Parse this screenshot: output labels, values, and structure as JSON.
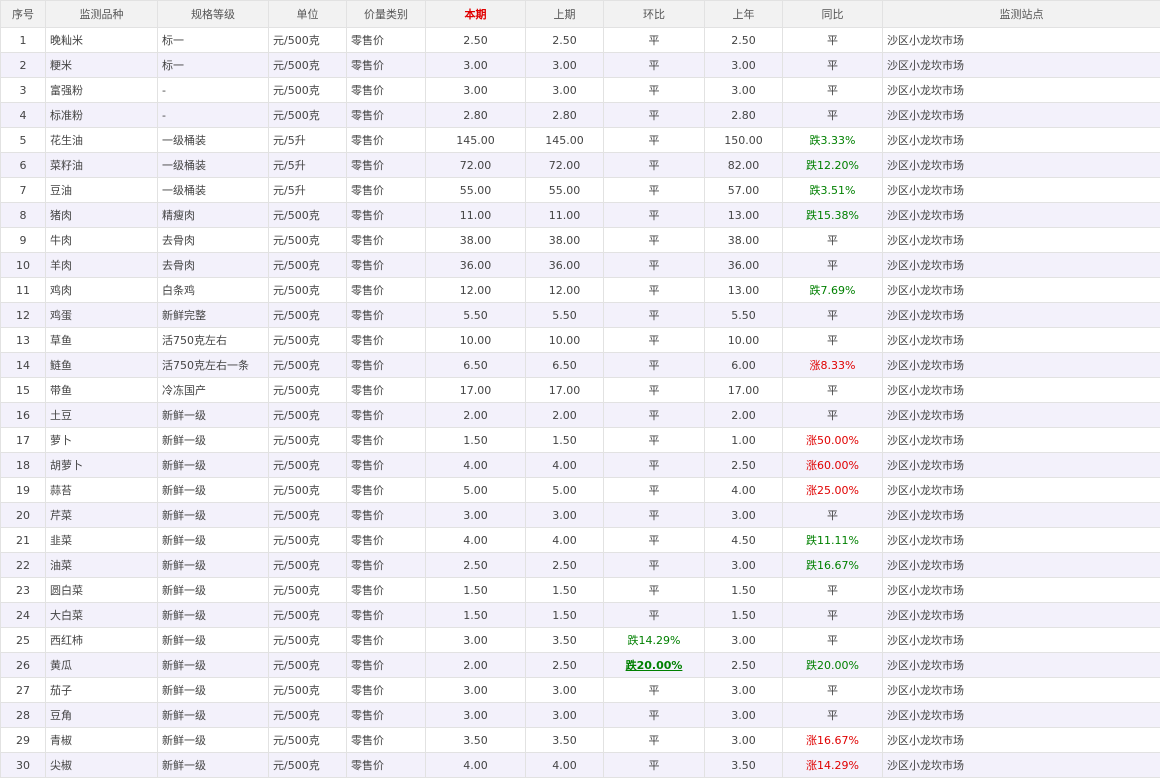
{
  "columns": [
    "序号",
    "监测品种",
    "规格等级",
    "单位",
    "价量类别",
    "本期",
    "上期",
    "环比",
    "上年",
    "同比",
    "监测站点"
  ],
  "colors": {
    "down": "#008000",
    "up": "#e00000",
    "header_bg": "#f2f2f2",
    "alt_row": "#f3f1fb"
  },
  "rows": [
    {
      "no": "1",
      "name": "晚籼米",
      "spec": "标一",
      "unit": "元/500克",
      "type": "零售价",
      "cur": "2.50",
      "prev": "2.50",
      "mom": "平",
      "mom_dir": "flat",
      "ly": "2.50",
      "yoy": "平",
      "yoy_dir": "flat",
      "site": "沙区小龙坎市场"
    },
    {
      "no": "2",
      "name": "粳米",
      "spec": "标一",
      "unit": "元/500克",
      "type": "零售价",
      "cur": "3.00",
      "prev": "3.00",
      "mom": "平",
      "mom_dir": "flat",
      "ly": "3.00",
      "yoy": "平",
      "yoy_dir": "flat",
      "site": "沙区小龙坎市场"
    },
    {
      "no": "3",
      "name": "富强粉",
      "spec": "-",
      "unit": "元/500克",
      "type": "零售价",
      "cur": "3.00",
      "prev": "3.00",
      "mom": "平",
      "mom_dir": "flat",
      "ly": "3.00",
      "yoy": "平",
      "yoy_dir": "flat",
      "site": "沙区小龙坎市场"
    },
    {
      "no": "4",
      "name": "标准粉",
      "spec": "-",
      "unit": "元/500克",
      "type": "零售价",
      "cur": "2.80",
      "prev": "2.80",
      "mom": "平",
      "mom_dir": "flat",
      "ly": "2.80",
      "yoy": "平",
      "yoy_dir": "flat",
      "site": "沙区小龙坎市场"
    },
    {
      "no": "5",
      "name": "花生油",
      "spec": "一级桶装",
      "unit": "元/5升",
      "type": "零售价",
      "cur": "145.00",
      "prev": "145.00",
      "mom": "平",
      "mom_dir": "flat",
      "ly": "150.00",
      "yoy": "跌3.33%",
      "yoy_dir": "down",
      "site": "沙区小龙坎市场"
    },
    {
      "no": "6",
      "name": "菜籽油",
      "spec": "一级桶装",
      "unit": "元/5升",
      "type": "零售价",
      "cur": "72.00",
      "prev": "72.00",
      "mom": "平",
      "mom_dir": "flat",
      "ly": "82.00",
      "yoy": "跌12.20%",
      "yoy_dir": "down",
      "site": "沙区小龙坎市场"
    },
    {
      "no": "7",
      "name": "豆油",
      "spec": "一级桶装",
      "unit": "元/5升",
      "type": "零售价",
      "cur": "55.00",
      "prev": "55.00",
      "mom": "平",
      "mom_dir": "flat",
      "ly": "57.00",
      "yoy": "跌3.51%",
      "yoy_dir": "down",
      "site": "沙区小龙坎市场"
    },
    {
      "no": "8",
      "name": "猪肉",
      "spec": "精瘦肉",
      "unit": "元/500克",
      "type": "零售价",
      "cur": "11.00",
      "prev": "11.00",
      "mom": "平",
      "mom_dir": "flat",
      "ly": "13.00",
      "yoy": "跌15.38%",
      "yoy_dir": "down",
      "site": "沙区小龙坎市场"
    },
    {
      "no": "9",
      "name": "牛肉",
      "spec": "去骨肉",
      "unit": "元/500克",
      "type": "零售价",
      "cur": "38.00",
      "prev": "38.00",
      "mom": "平",
      "mom_dir": "flat",
      "ly": "38.00",
      "yoy": "平",
      "yoy_dir": "flat",
      "site": "沙区小龙坎市场"
    },
    {
      "no": "10",
      "name": "羊肉",
      "spec": "去骨肉",
      "unit": "元/500克",
      "type": "零售价",
      "cur": "36.00",
      "prev": "36.00",
      "mom": "平",
      "mom_dir": "flat",
      "ly": "36.00",
      "yoy": "平",
      "yoy_dir": "flat",
      "site": "沙区小龙坎市场"
    },
    {
      "no": "11",
      "name": "鸡肉",
      "spec": "白条鸡",
      "unit": "元/500克",
      "type": "零售价",
      "cur": "12.00",
      "prev": "12.00",
      "mom": "平",
      "mom_dir": "flat",
      "ly": "13.00",
      "yoy": "跌7.69%",
      "yoy_dir": "down",
      "site": "沙区小龙坎市场"
    },
    {
      "no": "12",
      "name": "鸡蛋",
      "spec": "新鲜完整",
      "unit": "元/500克",
      "type": "零售价",
      "cur": "5.50",
      "prev": "5.50",
      "mom": "平",
      "mom_dir": "flat",
      "ly": "5.50",
      "yoy": "平",
      "yoy_dir": "flat",
      "site": "沙区小龙坎市场"
    },
    {
      "no": "13",
      "name": "草鱼",
      "spec": "活750克左右",
      "unit": "元/500克",
      "type": "零售价",
      "cur": "10.00",
      "prev": "10.00",
      "mom": "平",
      "mom_dir": "flat",
      "ly": "10.00",
      "yoy": "平",
      "yoy_dir": "flat",
      "site": "沙区小龙坎市场"
    },
    {
      "no": "14",
      "name": "鲢鱼",
      "spec": "活750克左右一条",
      "unit": "元/500克",
      "type": "零售价",
      "cur": "6.50",
      "prev": "6.50",
      "mom": "平",
      "mom_dir": "flat",
      "ly": "6.00",
      "yoy": "涨8.33%",
      "yoy_dir": "up",
      "site": "沙区小龙坎市场"
    },
    {
      "no": "15",
      "name": "带鱼",
      "spec": "冷冻国产",
      "unit": "元/500克",
      "type": "零售价",
      "cur": "17.00",
      "prev": "17.00",
      "mom": "平",
      "mom_dir": "flat",
      "ly": "17.00",
      "yoy": "平",
      "yoy_dir": "flat",
      "site": "沙区小龙坎市场"
    },
    {
      "no": "16",
      "name": "土豆",
      "spec": "新鲜一级",
      "unit": "元/500克",
      "type": "零售价",
      "cur": "2.00",
      "prev": "2.00",
      "mom": "平",
      "mom_dir": "flat",
      "ly": "2.00",
      "yoy": "平",
      "yoy_dir": "flat",
      "site": "沙区小龙坎市场"
    },
    {
      "no": "17",
      "name": "萝卜",
      "spec": "新鲜一级",
      "unit": "元/500克",
      "type": "零售价",
      "cur": "1.50",
      "prev": "1.50",
      "mom": "平",
      "mom_dir": "flat",
      "ly": "1.00",
      "yoy": "涨50.00%",
      "yoy_dir": "up",
      "site": "沙区小龙坎市场"
    },
    {
      "no": "18",
      "name": "胡萝卜",
      "spec": "新鲜一级",
      "unit": "元/500克",
      "type": "零售价",
      "cur": "4.00",
      "prev": "4.00",
      "mom": "平",
      "mom_dir": "flat",
      "ly": "2.50",
      "yoy": "涨60.00%",
      "yoy_dir": "up",
      "site": "沙区小龙坎市场"
    },
    {
      "no": "19",
      "name": "蒜苔",
      "spec": "新鲜一级",
      "unit": "元/500克",
      "type": "零售价",
      "cur": "5.00",
      "prev": "5.00",
      "mom": "平",
      "mom_dir": "flat",
      "ly": "4.00",
      "yoy": "涨25.00%",
      "yoy_dir": "up",
      "site": "沙区小龙坎市场"
    },
    {
      "no": "20",
      "name": "芹菜",
      "spec": "新鲜一级",
      "unit": "元/500克",
      "type": "零售价",
      "cur": "3.00",
      "prev": "3.00",
      "mom": "平",
      "mom_dir": "flat",
      "ly": "3.00",
      "yoy": "平",
      "yoy_dir": "flat",
      "site": "沙区小龙坎市场"
    },
    {
      "no": "21",
      "name": "韭菜",
      "spec": "新鲜一级",
      "unit": "元/500克",
      "type": "零售价",
      "cur": "4.00",
      "prev": "4.00",
      "mom": "平",
      "mom_dir": "flat",
      "ly": "4.50",
      "yoy": "跌11.11%",
      "yoy_dir": "down",
      "site": "沙区小龙坎市场"
    },
    {
      "no": "22",
      "name": "油菜",
      "spec": "新鲜一级",
      "unit": "元/500克",
      "type": "零售价",
      "cur": "2.50",
      "prev": "2.50",
      "mom": "平",
      "mom_dir": "flat",
      "ly": "3.00",
      "yoy": "跌16.67%",
      "yoy_dir": "down",
      "site": "沙区小龙坎市场"
    },
    {
      "no": "23",
      "name": "圆白菜",
      "spec": "新鲜一级",
      "unit": "元/500克",
      "type": "零售价",
      "cur": "1.50",
      "prev": "1.50",
      "mom": "平",
      "mom_dir": "flat",
      "ly": "1.50",
      "yoy": "平",
      "yoy_dir": "flat",
      "site": "沙区小龙坎市场"
    },
    {
      "no": "24",
      "name": "大白菜",
      "spec": "新鲜一级",
      "unit": "元/500克",
      "type": "零售价",
      "cur": "1.50",
      "prev": "1.50",
      "mom": "平",
      "mom_dir": "flat",
      "ly": "1.50",
      "yoy": "平",
      "yoy_dir": "flat",
      "site": "沙区小龙坎市场"
    },
    {
      "no": "25",
      "name": "西红柿",
      "spec": "新鲜一级",
      "unit": "元/500克",
      "type": "零售价",
      "cur": "3.00",
      "prev": "3.50",
      "mom": "跌14.29%",
      "mom_dir": "down",
      "ly": "3.00",
      "yoy": "平",
      "yoy_dir": "flat",
      "site": "沙区小龙坎市场"
    },
    {
      "no": "26",
      "name": "黄瓜",
      "spec": "新鲜一级",
      "unit": "元/500克",
      "type": "零售价",
      "cur": "2.00",
      "prev": "2.50",
      "mom": "跌20.00%",
      "mom_dir": "down",
      "mom_emph": true,
      "ly": "2.50",
      "yoy": "跌20.00%",
      "yoy_dir": "down",
      "site": "沙区小龙坎市场"
    },
    {
      "no": "27",
      "name": "茄子",
      "spec": "新鲜一级",
      "unit": "元/500克",
      "type": "零售价",
      "cur": "3.00",
      "prev": "3.00",
      "mom": "平",
      "mom_dir": "flat",
      "ly": "3.00",
      "yoy": "平",
      "yoy_dir": "flat",
      "site": "沙区小龙坎市场"
    },
    {
      "no": "28",
      "name": "豆角",
      "spec": "新鲜一级",
      "unit": "元/500克",
      "type": "零售价",
      "cur": "3.00",
      "prev": "3.00",
      "mom": "平",
      "mom_dir": "flat",
      "ly": "3.00",
      "yoy": "平",
      "yoy_dir": "flat",
      "site": "沙区小龙坎市场"
    },
    {
      "no": "29",
      "name": "青椒",
      "spec": "新鲜一级",
      "unit": "元/500克",
      "type": "零售价",
      "cur": "3.50",
      "prev": "3.50",
      "mom": "平",
      "mom_dir": "flat",
      "ly": "3.00",
      "yoy": "涨16.67%",
      "yoy_dir": "up",
      "site": "沙区小龙坎市场"
    },
    {
      "no": "30",
      "name": "尖椒",
      "spec": "新鲜一级",
      "unit": "元/500克",
      "type": "零售价",
      "cur": "4.00",
      "prev": "4.00",
      "mom": "平",
      "mom_dir": "flat",
      "ly": "3.50",
      "yoy": "涨14.29%",
      "yoy_dir": "up",
      "site": "沙区小龙坎市场"
    }
  ]
}
